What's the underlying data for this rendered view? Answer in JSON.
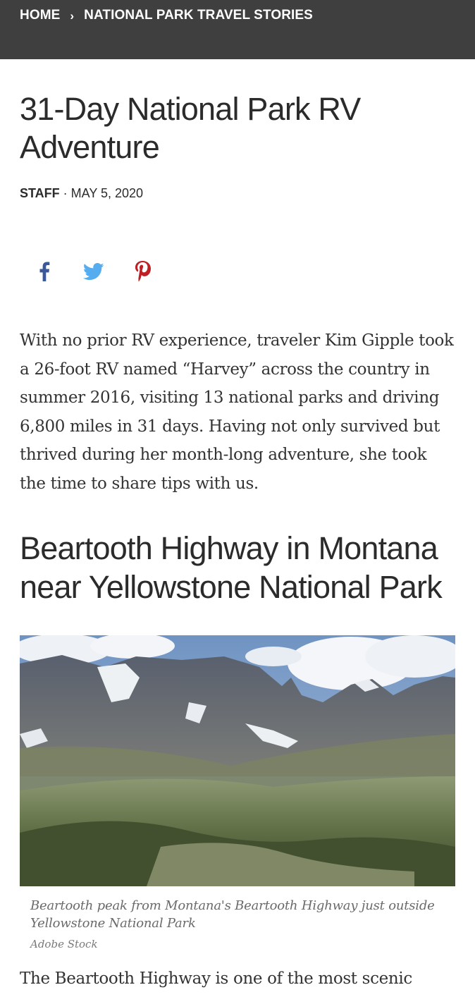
{
  "breadcrumb": {
    "home": "HOME",
    "separator": "›",
    "section": "NATIONAL PARK TRAVEL STORIES"
  },
  "article": {
    "title": "31-Day National Park RV Adventure",
    "author": "STAFF",
    "date_separator": "·",
    "date": "MAY 5, 2020",
    "lede": "With no prior RV experience, traveler Kim Gipple took a 26-foot RV named “Harvey” across the country in summer 2016, visiting 13 national parks and driving 6,800 miles in 31 days. Having not only survived but thrived during her month-long adventure, she took the time to share tips with us.",
    "section_heading": "Beartooth Highway in Montana near Yellowstone National Park",
    "image": {
      "caption": "Beartooth peak from Montana's Beartooth Highway just outside Yellowstone National Park",
      "credit": "Adobe Stock"
    },
    "body_start": "The Beartooth Highway is one of the most scenic"
  },
  "share": {
    "icons": [
      "facebook-icon",
      "twitter-icon",
      "pinterest-icon"
    ]
  },
  "colors": {
    "header_bg": "#3f3f3f",
    "facebook": "#3b5998",
    "twitter": "#55acee",
    "pinterest": "#bd2125"
  }
}
